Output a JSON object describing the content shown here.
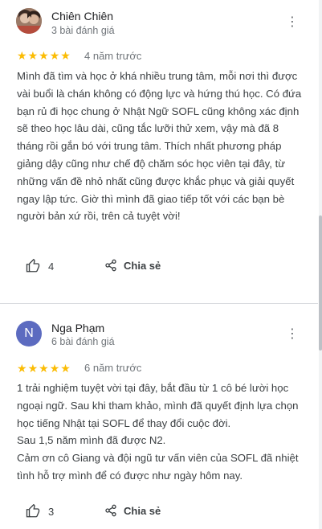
{
  "reviews": [
    {
      "author": "Chiên Chiên",
      "review_count": "3 bài đánh giá",
      "rating": 5,
      "time": "4 năm trước",
      "text": "Mình đã tìm và học ở khá nhiều trung tâm, mỗi nơi thì được vài buổi là chán không có động lực và hứng thú học. Có đứa bạn rủ đi học chung ở Nhật Ngữ SOFL cũng không xác định sẽ theo học lâu dài, cũng tắc lưỡi thử xem, vậy mà đã 8 tháng rồi gắn bó với trung tâm. Thích nhất phương pháp giảng dậy cũng như chế độ chăm sóc học viên tại đây, từ những vấn đề nhỏ nhất cũng được khắc phục và giải quyết ngay lập tức. Giờ thì mình đã giao tiếp tốt với các bạn bè người bản xứ rồi, trên cả tuyệt vời!",
      "likes": "4",
      "share_label": "Chia sẻ",
      "avatar": "photo"
    },
    {
      "author": "Nga Phạm",
      "review_count": "6 bài đánh giá",
      "rating": 5,
      "time": "6 năm trước",
      "avatar_letter": "N",
      "text_lines": [
        "1 trải nghiệm tuyệt vời tại đây, bắt đầu từ 1 cô bé lười học ngoại ngữ. Sau khi tham khảo, mình đã quyết định lựa chọn học tiếng Nhật tại SOFL để thay đổi cuộc đời.",
        "Sau 1,5 năm mình đã được N2.",
        "Cảm ơn cô Giang và đội ngũ tư vấn viên của SOFL đã nhiệt tình hỗ trợ mình để có được như ngày hôm nay."
      ],
      "likes": "3",
      "share_label": "Chia sẻ"
    }
  ],
  "icons": {
    "star": "star-icon",
    "like": "thumbs-up-icon",
    "share": "share-icon",
    "menu": "more-vert-icon"
  },
  "colors": {
    "star": "#fbbc04",
    "avatar_n": "#5c6bc0",
    "secondary_text": "#70757a"
  }
}
